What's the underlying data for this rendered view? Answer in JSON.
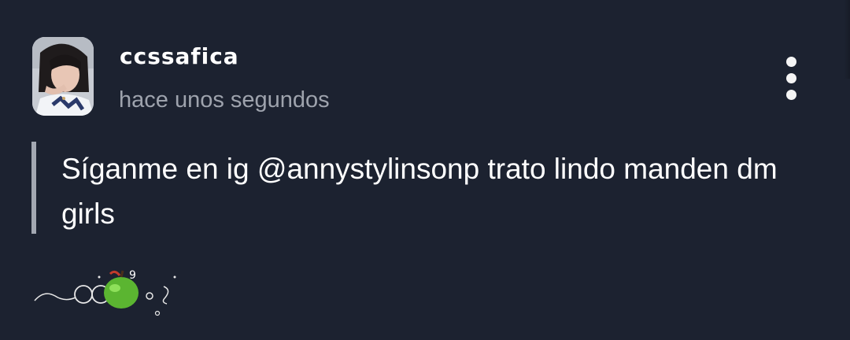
{
  "post": {
    "author": "ccssafica",
    "timestamp": "hace unos segundos",
    "text": "Síganme en ig @annystylinsonp trato lindo manden dm girls"
  },
  "icons": {
    "avatar": "profile-photo",
    "menu": "more-vertical-icon",
    "signature": "green-apple-doodle"
  },
  "colors": {
    "background": "#1c2230",
    "text": "#ffffff",
    "muted": "#9ea3ad",
    "quote_bar": "#a3a8b2"
  }
}
